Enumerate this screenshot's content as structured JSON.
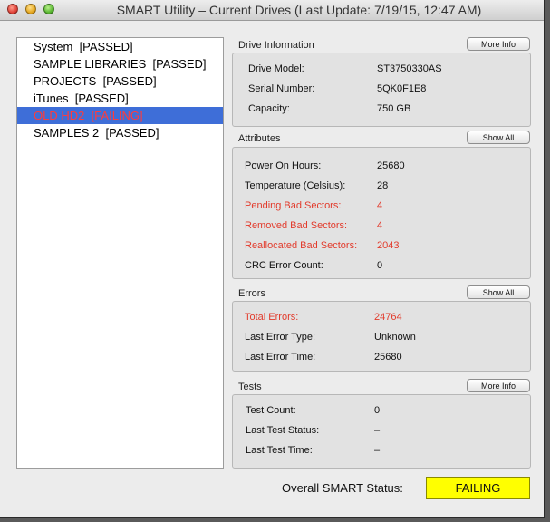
{
  "window": {
    "title": "SMART Utility – Current Drives (Last Update: 7/19/15, 12:47 AM)"
  },
  "drives": [
    {
      "label": "System  [PASSED]",
      "selected": false
    },
    {
      "label": "SAMPLE LIBRARIES  [PASSED]",
      "selected": false
    },
    {
      "label": "PROJECTS  [PASSED]",
      "selected": false
    },
    {
      "label": "iTunes  [PASSED]",
      "selected": false
    },
    {
      "label": "OLD HD2  [FAILING]",
      "selected": true
    },
    {
      "label": "SAMPLES 2  [PASSED]",
      "selected": false
    }
  ],
  "drive_info": {
    "heading": "Drive Information",
    "button": "More Info",
    "model_label": "Drive Model:",
    "model": "ST3750330AS",
    "serial_label": "Serial Number:",
    "serial": "5QK0F1E8",
    "capacity_label": "Capacity:",
    "capacity": "750 GB"
  },
  "attributes": {
    "heading": "Attributes",
    "button": "Show All",
    "rows": [
      {
        "label": "Power On Hours:",
        "value": "25680",
        "alert": false
      },
      {
        "label": "Temperature (Celsius):",
        "value": "28",
        "alert": false
      },
      {
        "label": "Pending Bad Sectors:",
        "value": "4",
        "alert": true
      },
      {
        "label": "Removed Bad Sectors:",
        "value": "4",
        "alert": true
      },
      {
        "label": "Reallocated Bad Sectors:",
        "value": "2043",
        "alert": true
      },
      {
        "label": "CRC Error Count:",
        "value": "0",
        "alert": false
      }
    ]
  },
  "errors": {
    "heading": "Errors",
    "button": "Show All",
    "rows": [
      {
        "label": "Total Errors:",
        "value": "24764",
        "alert": true
      },
      {
        "label": "Last Error Type:",
        "value": "Unknown",
        "alert": false
      },
      {
        "label": "Last Error Time:",
        "value": "25680",
        "alert": false
      }
    ]
  },
  "tests": {
    "heading": "Tests",
    "button": "More Info",
    "rows": [
      {
        "label": "Test Count:",
        "value": "0"
      },
      {
        "label": "Last Test Status:",
        "value": "–"
      },
      {
        "label": "Last Test Time:",
        "value": "–"
      }
    ]
  },
  "overall": {
    "label": "Overall SMART Status:",
    "value": "FAILING",
    "color": "#ffff00"
  },
  "colors": {
    "alert": "#e23a2b",
    "selection": "#3e6ed8"
  }
}
